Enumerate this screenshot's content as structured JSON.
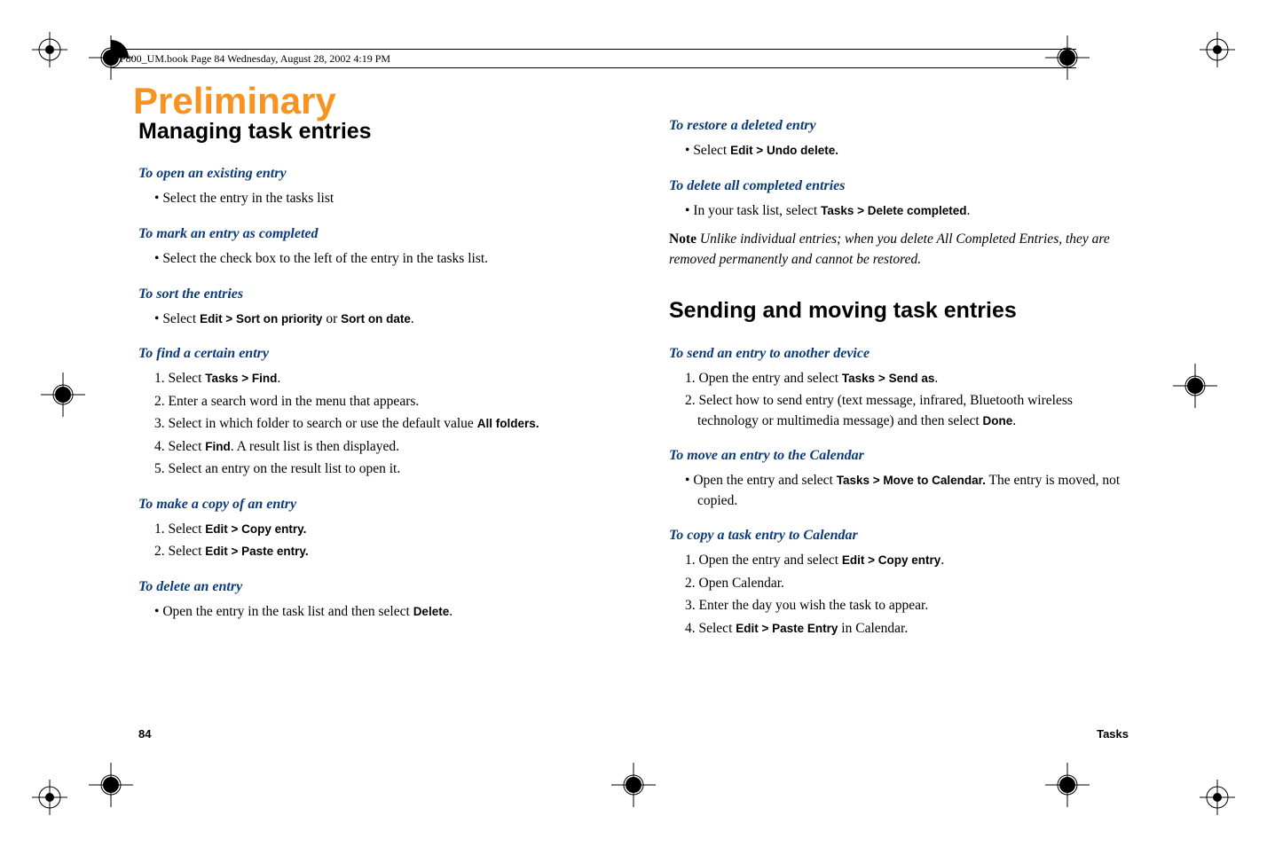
{
  "header": {
    "running": "P800_UM.book  Page 84  Wednesday, August 28, 2002  4:19 PM"
  },
  "watermark": "Preliminary",
  "left": {
    "h2": "Managing task entries",
    "s1": {
      "title": "To open an existing entry",
      "b1": "Select the entry in the tasks list"
    },
    "s2": {
      "title": "To mark an entry as completed",
      "b1": "Select the check box to the left of the entry in the tasks list."
    },
    "s3": {
      "title": "To sort the entries",
      "b1_pre": "Select ",
      "b1_ui1": "Edit > Sort on priority",
      "b1_mid": " or ",
      "b1_ui2": "Sort on date",
      "b1_post": "."
    },
    "s4": {
      "title": "To find a certain entry",
      "n1_pre": "1.  Select ",
      "n1_ui": "Tasks > Find",
      "n1_post": ".",
      "n2": "2.  Enter a search word in the menu that appears.",
      "n3_pre": "3.  Select in which folder to search or use the default value ",
      "n3_ui": "All folders.",
      "n4_pre": "4.  Select ",
      "n4_ui": "Find",
      "n4_post": ". A result list is then displayed.",
      "n5": "5.  Select an entry on the result list to open it."
    },
    "s5": {
      "title": "To make a copy of an entry",
      "n1_pre": "1.  Select ",
      "n1_ui": "Edit > Copy entry.",
      "n2_pre": "2.  Select ",
      "n2_ui": "Edit > Paste entry."
    },
    "s6": {
      "title": "To delete an entry",
      "b1_pre": "Open the entry in the task list and then select ",
      "b1_ui": "Delete",
      "b1_post": "."
    }
  },
  "right": {
    "s1": {
      "title": "To restore a deleted entry",
      "b1_pre": "Select ",
      "b1_ui": "Edit > Undo delete."
    },
    "s2": {
      "title": "To delete all completed entries",
      "b1_pre": "In your task list, select ",
      "b1_ui": "Tasks > Delete completed",
      "b1_post": "."
    },
    "note": {
      "label": "Note",
      "text": " Unlike individual entries; when you delete All Completed Entries, they are removed permanently and cannot be restored."
    },
    "h2": "Sending and moving task entries",
    "s3": {
      "title": "To send an entry to another device",
      "n1_pre": "1.  Open the entry and select ",
      "n1_ui": "Tasks > Send as",
      "n1_post": ".",
      "n2_pre": "2.  Select how to send entry (text message, infrared, Bluetooth wireless technology or multimedia message) and then select ",
      "n2_ui": "Done",
      "n2_post": "."
    },
    "s4": {
      "title": "To move an entry to the Calendar",
      "b1_pre": "Open the entry and select ",
      "b1_ui": "Tasks > Move to Calendar.",
      "b1_post": " The entry is moved, not copied."
    },
    "s5": {
      "title": "To copy a task entry to Calendar",
      "n1_pre": "1.  Open the entry and select ",
      "n1_ui": "Edit > Copy entry",
      "n1_post": ".",
      "n2": "2.  Open Calendar.",
      "n3": "3.  Enter the day you wish the task to appear.",
      "n4_pre": "4.  Select ",
      "n4_ui": "Edit > Paste Entry",
      "n4_post": " in Calendar."
    }
  },
  "footer": {
    "page": "84",
    "section": "Tasks"
  }
}
